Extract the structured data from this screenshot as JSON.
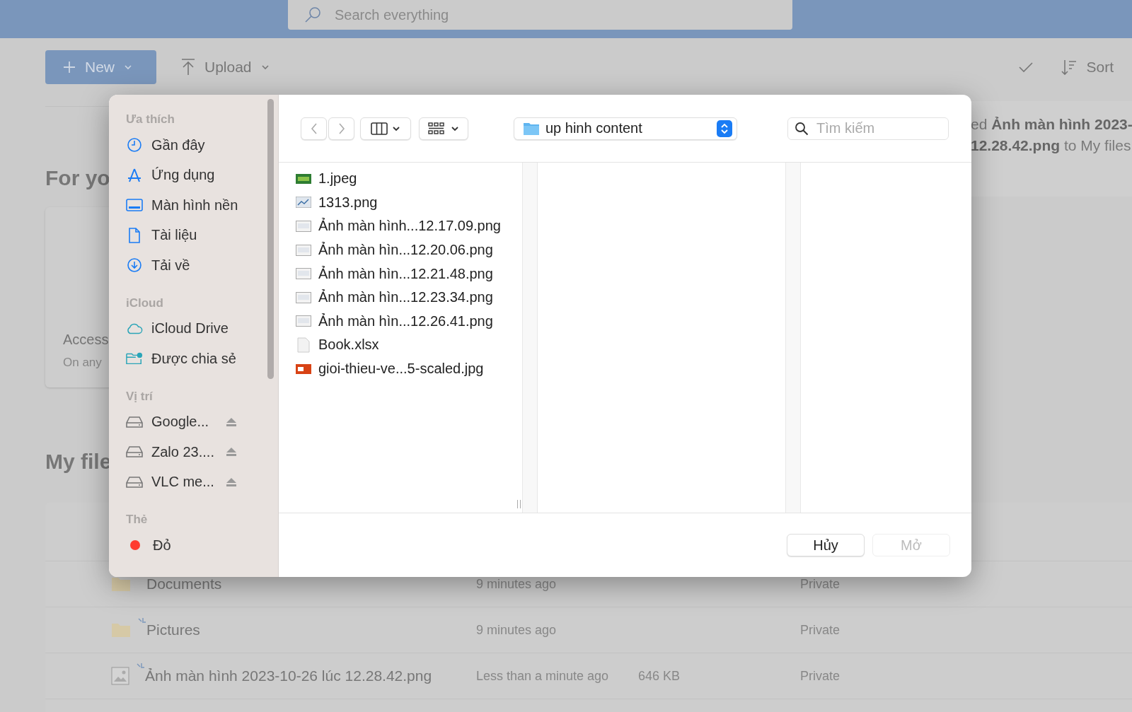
{
  "top_bar": {
    "search": {
      "placeholder": "Search everything"
    }
  },
  "toolbar": {
    "new_button": "New",
    "upload_button": "Upload",
    "sort_button": "Sort"
  },
  "for_you": {
    "heading": "For yo",
    "card": {
      "title": "Access",
      "subtitle": "On any"
    },
    "notice": [
      "ed **Ảnh màn hình 2023-**",
      "**12.28.42.png** to My files"
    ]
  },
  "my_files": {
    "heading": "My file",
    "rows": [
      {
        "kind": "folder",
        "name": "Documents",
        "modified": "9 minutes ago",
        "sharing": "Private",
        "new": false
      },
      {
        "kind": "folder",
        "name": "Pictures",
        "modified": "9 minutes ago",
        "sharing": "Private",
        "new": true
      },
      {
        "kind": "image",
        "name": "Ảnh màn hình 2023-10-26 lúc 12.28.42.png",
        "modified": "Less than a minute ago",
        "size": "646 KB",
        "sharing": "Private",
        "new": true
      }
    ]
  },
  "dialog": {
    "sidebar": [
      {
        "heading": "Ưa thích",
        "items": [
          {
            "kind": "clock",
            "label": "Gần đây"
          },
          {
            "kind": "apps",
            "label": "Ứng dụng"
          },
          {
            "kind": "desktop",
            "label": "Màn hình nền"
          },
          {
            "kind": "document",
            "label": "Tài liệu"
          },
          {
            "kind": "download",
            "label": "Tải về"
          }
        ]
      },
      {
        "heading": "iCloud",
        "items": [
          {
            "kind": "cloud",
            "label": "iCloud Drive"
          },
          {
            "kind": "shared",
            "label": "Được chia sẻ"
          }
        ]
      },
      {
        "heading": "Vị trí",
        "items": [
          {
            "kind": "drive",
            "label": "Google..."
          },
          {
            "kind": "drive",
            "label": "Zalo 23...."
          },
          {
            "kind": "drive",
            "label": "VLC me..."
          }
        ]
      },
      {
        "heading": "Thẻ",
        "items": [
          {
            "kind": "tag",
            "label": "Đỏ",
            "color": "#ff3b30"
          }
        ]
      }
    ],
    "location": "up hinh content",
    "search": {
      "placeholder": "Tìm kiếm"
    },
    "files": [
      {
        "kind": "photo",
        "name": "1.jpeg"
      },
      {
        "kind": "chart",
        "name": "1313.png"
      },
      {
        "kind": "screenshot",
        "name": "Ảnh màn hình...12.17.09.png"
      },
      {
        "kind": "screenshot",
        "name": "Ảnh màn hìn...12.20.06.png"
      },
      {
        "kind": "screenshot",
        "name": "Ảnh màn hìn...12.21.48.png"
      },
      {
        "kind": "screenshot",
        "name": "Ảnh màn hìn...12.23.34.png"
      },
      {
        "kind": "screenshot",
        "name": "Ảnh màn hìn...12.26.41.png"
      },
      {
        "kind": "blank",
        "name": "Book.xlsx"
      },
      {
        "kind": "slide",
        "name": "gioi-thieu-ve...5-scaled.jpg"
      }
    ],
    "buttons": [
      {
        "label": "Hủy",
        "disabled": false
      },
      {
        "label": "Mở",
        "disabled": true
      }
    ]
  }
}
